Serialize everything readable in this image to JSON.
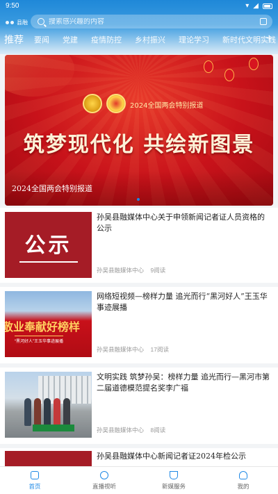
{
  "status": {
    "time": "9:50"
  },
  "logo": {
    "text": "县融"
  },
  "search": {
    "placeholder": "搜索感兴趣的内容"
  },
  "tabs": [
    {
      "label": "推荐"
    },
    {
      "label": "要闻"
    },
    {
      "label": "党建"
    },
    {
      "label": "疫情防控"
    },
    {
      "label": "乡村振兴"
    },
    {
      "label": "理论学习"
    },
    {
      "label": "新时代文明实践"
    }
  ],
  "tabs_more": "+",
  "banner": {
    "subtitle": "2024全国两会特别报道",
    "headline": "筑梦现代化 共绘新图景",
    "caption": "2024全国两会特别报道"
  },
  "news": [
    {
      "thumb_text": "公示",
      "title": "孙吴县融媒体中心关于申领新闻记者证人员资格的公示",
      "source": "孙吴县融媒体中心",
      "reads": "9阅读"
    },
    {
      "thumb_text": "敬业奉献好榜样",
      "thumb_sub": "“黑河好人”王玉华事迹展播",
      "title": "网络短视频—榜样力量 追光而行“黑河好人”王玉华事迹展播",
      "source": "孙吴县融媒体中心",
      "reads": "17阅读"
    },
    {
      "title": "文明实践 筑梦孙吴：榜样力量 追光而行—黑河市第二届道德模范提名奖李广福",
      "source": "孙吴县融媒体中心",
      "reads": "8阅读"
    },
    {
      "title": "孙吴县融媒体中心新闻记者证2024年检公示"
    }
  ],
  "nav": [
    {
      "label": "首页",
      "icon": "home-icon"
    },
    {
      "label": "直播视听",
      "icon": "tv-icon"
    },
    {
      "label": "新媒服务",
      "icon": "cup-icon"
    },
    {
      "label": "我的",
      "icon": "user-icon"
    }
  ],
  "colors": {
    "primary": "#1e88e5",
    "red": "#c8121a"
  }
}
